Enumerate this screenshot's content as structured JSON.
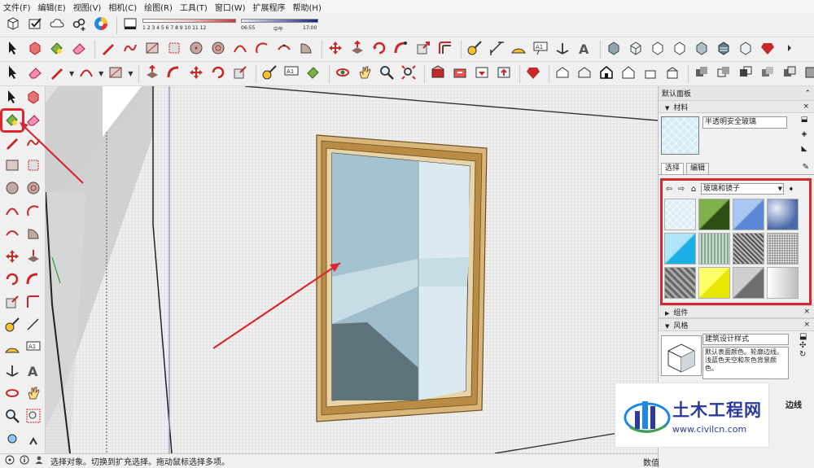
{
  "menu": [
    "文件(F)",
    "编辑(E)",
    "视图(V)",
    "相机(C)",
    "绘图(R)",
    "工具(T)",
    "窗口(W)",
    "扩展程序",
    "帮助(H)"
  ],
  "shadow": {
    "month_ticks": "1 2 3 4 5 6 7 8 9 10 11 12",
    "time_start": "06:55",
    "time_mid": "中午",
    "time_end": "17:00"
  },
  "tray": {
    "title": "默认面板",
    "materials_header": "材料",
    "material_name": "半透明安全玻璃",
    "tab_select": "选择",
    "tab_edit": "编辑",
    "collection": "玻璃和镜子",
    "swatches": [
      "#dbeef6",
      "#3f6b23",
      "#7fa6e6",
      "#5b78b8",
      "#5ec9ee",
      "#9fbfad",
      "#8a8a8a",
      "#b5b5b5",
      "#7a7a7a",
      "#f2f200",
      "#9a9a9a",
      "#d0d0d0"
    ],
    "components_header": "组件",
    "styles_header": "风格",
    "style_name": "建筑设计样式",
    "style_desc": "默认表面颜色。轮廓边线。浅蓝色天空和灰色背景颜色。",
    "edges_label": "边线"
  },
  "status": {
    "text": "选择对象。切换到扩充选择。拖动鼠标选择多项。",
    "measure_label": "数值"
  },
  "watermark": {
    "brand": "土木工程网",
    "url": "www.civilcn.com"
  },
  "colors": {
    "highlight": "#d8282e",
    "glass": "#b8d6e2",
    "frame": "#d9b57a"
  }
}
